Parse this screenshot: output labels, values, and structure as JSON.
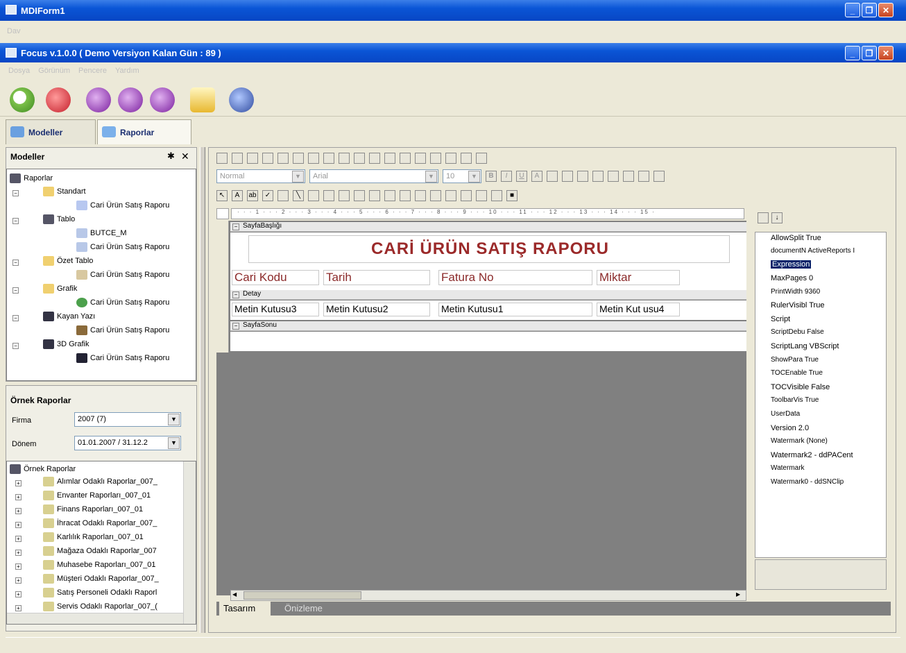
{
  "window": {
    "outer_title": "MDIForm1",
    "outer_menu": "Dav",
    "inner_title": "Focus v.1.0.0 ( Demo Versiyon Kalan Gün : 89 )"
  },
  "menu": [
    "Dosya",
    "Görünüm",
    "Pencere",
    "Yardım"
  ],
  "tabs": [
    {
      "label": "Modeller"
    },
    {
      "label": "Raporlar"
    }
  ],
  "models_panel": {
    "title": "Modeller",
    "pin": "✱",
    "close": "✕",
    "tree": [
      {
        "label": "Raporlar"
      },
      {
        "label": "Standart"
      },
      {
        "label": "Cari Ürün Satış Raporu"
      },
      {
        "label": "Tablo"
      },
      {
        "label": "BUTCE_M"
      },
      {
        "label": "Cari Ürün Satış Raporu"
      },
      {
        "label": "Özet Tablo"
      },
      {
        "label": "Cari Ürün Satış Raporu"
      },
      {
        "label": "Grafik"
      },
      {
        "label": "Cari Ürün Satış Raporu"
      },
      {
        "label": "Kayan Yazı"
      },
      {
        "label": "Cari Ürün Satış Raporu"
      },
      {
        "label": "3D Grafik"
      },
      {
        "label": "Cari Ürün Satış Raporu"
      }
    ]
  },
  "sample_panel": {
    "title": "Örnek Raporlar",
    "firma_label": "Firma",
    "firma_value": "2007 (7)",
    "donem_label": "Dönem",
    "donem_value": "01.01.2007 / 31.12.2",
    "tree": [
      {
        "label": "Örnek Raporlar"
      },
      {
        "label": "Alımlar Odaklı Raporlar_007_"
      },
      {
        "label": "Envanter Raporları_007_01"
      },
      {
        "label": "Finans Raporları_007_01"
      },
      {
        "label": "İhracat Odaklı Raporlar_007_"
      },
      {
        "label": "Karlılık Raporları_007_01"
      },
      {
        "label": "Mağaza Odaklı Raporlar_007"
      },
      {
        "label": "Muhasebe Raporları_007_01"
      },
      {
        "label": "Müşteri Odaklı Raporlar_007_"
      },
      {
        "label": "Satış Personeli Odaklı Raporl"
      },
      {
        "label": "Servis Odaklı Raporlar_007_("
      }
    ]
  },
  "designer": {
    "style_combo": "Normal",
    "font_combo": "Arial",
    "size_combo": "10",
    "ruler": "· · · 1 · · · 2 · · · 3 · · · 4 · · · 5 · · · 6 · · · 7 · · · 8 · · · 9 · · · 10 · · · 11 · · · 12 · · · 13 · · · 14 · · · 15 ·",
    "bands": {
      "page_header": "SayfaBaşlığı",
      "detail": "Detay",
      "page_footer": "SayfaSonu"
    },
    "report_title": "CARİ ÜRÜN SATIŞ RAPORU",
    "headers": [
      "Cari Kodu",
      "Tarih",
      "Fatura No",
      "Miktar"
    ],
    "detail_fields": [
      "Metin Kutusu3",
      "Metin Kutusu2",
      "Metin Kutusu1",
      "Metin Kut usu4"
    ],
    "bottom_tabs": [
      "Tasarım",
      "Önizleme"
    ]
  },
  "properties": [
    {
      "name": "AllowSplit",
      "value": "True"
    },
    {
      "name": "documentN",
      "value": "ActiveReports I"
    },
    {
      "name": "Expression",
      "value": ""
    },
    {
      "name": "MaxPages",
      "value": "0"
    },
    {
      "name": "PrintWidth",
      "value": "9360"
    },
    {
      "name": "RulerVisibl",
      "value": "True"
    },
    {
      "name": "Script",
      "value": ""
    },
    {
      "name": "ScriptDebu",
      "value": "False"
    },
    {
      "name": "ScriptLang",
      "value": "VBScript"
    },
    {
      "name": "ShowPara",
      "value": "True"
    },
    {
      "name": "TOCEnable",
      "value": "True"
    },
    {
      "name": "TOCVisible",
      "value": "False"
    },
    {
      "name": "ToolbarVis",
      "value": "True"
    },
    {
      "name": "UserData",
      "value": ""
    },
    {
      "name": "Version",
      "value": "2.0"
    },
    {
      "name": "Watermark",
      "value": "(None)"
    },
    {
      "name": "Watermark2",
      "value": "- ddPACent"
    },
    {
      "name": "Watermark",
      "value": ""
    },
    {
      "name": "Watermark0",
      "value": "- ddSNClip"
    }
  ]
}
